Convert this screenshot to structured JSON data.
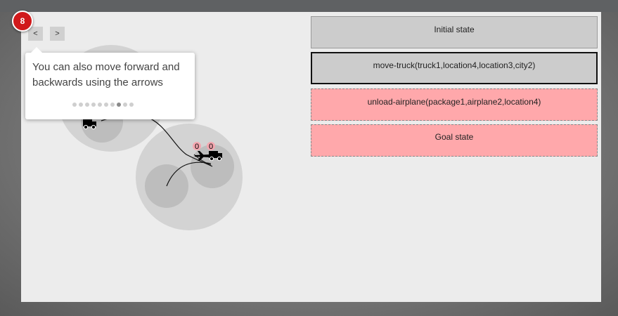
{
  "tour": {
    "step": "8",
    "tooltip_text": "You can also move forward and backwards using the arrows",
    "dots_total": 10,
    "dots_active_index": 7
  },
  "nav": {
    "prev_label": "<",
    "next_label": ">"
  },
  "map": {
    "package_counts": [
      "0",
      "0"
    ]
  },
  "plan": {
    "initial_label": "Initial state",
    "steps": [
      "move-truck(truck1,location4,location3,city2)",
      "unload-airplane(package1,airplane2,location4)"
    ],
    "goal_label": "Goal state"
  },
  "colors": {
    "pending_step": "#ffa8ab",
    "done_step": "#cccccc",
    "badge": "#d0191b"
  }
}
